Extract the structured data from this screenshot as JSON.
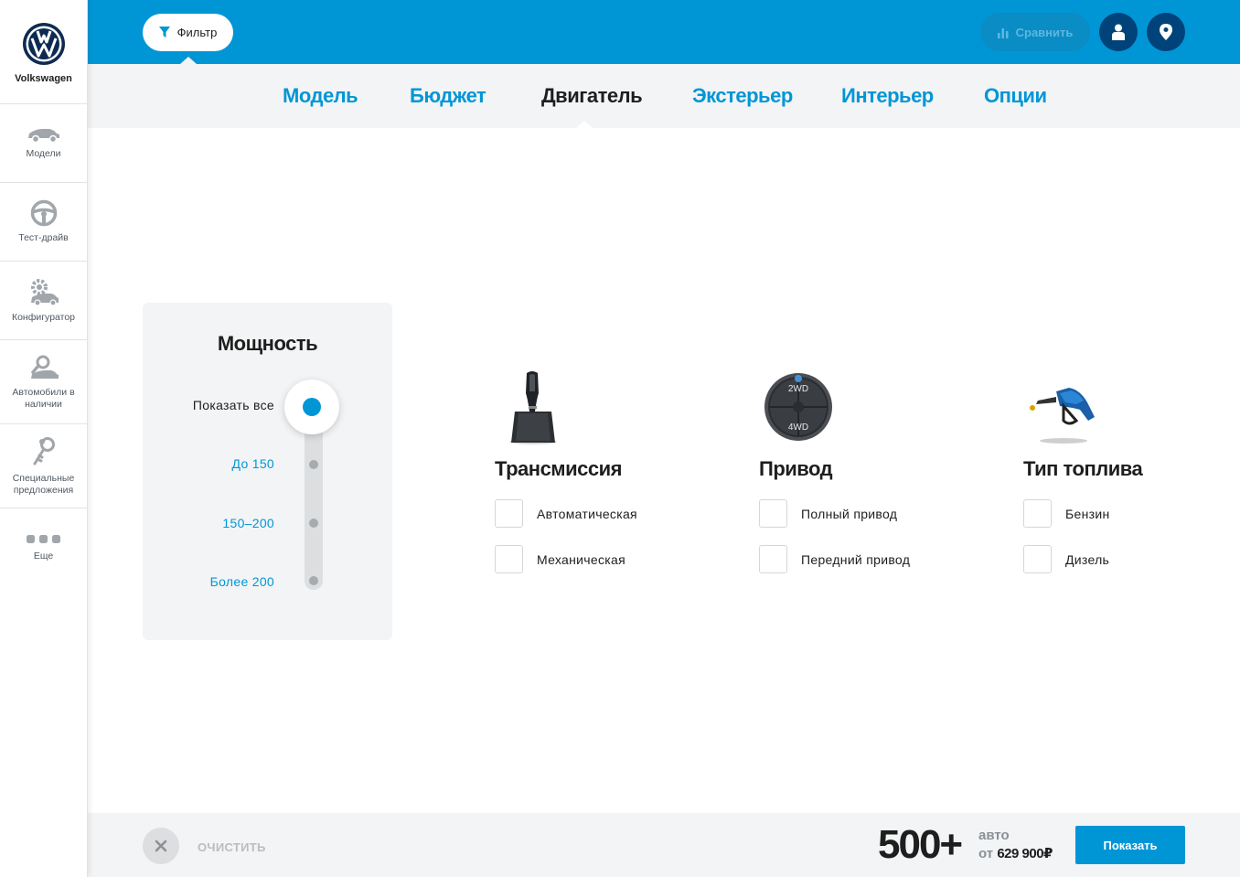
{
  "brand": {
    "name": "Volkswagen"
  },
  "sidebar": {
    "items": [
      {
        "label": "Модели",
        "icon": "car-icon"
      },
      {
        "label": "Тест-драйв",
        "icon": "steering-wheel-icon"
      },
      {
        "label": "Конфигуратор",
        "icon": "configurator-icon"
      },
      {
        "label": "Автомобили в наличии",
        "icon": "car-search-icon"
      },
      {
        "label": "Специальные предложения",
        "icon": "key-icon"
      },
      {
        "label": "Еще",
        "icon": "more-icon"
      }
    ]
  },
  "header": {
    "filter_label": "Фильтр",
    "compare_label": "Сравнить"
  },
  "tabs": [
    {
      "label": "Модель",
      "active": false
    },
    {
      "label": "Бюджет",
      "active": false
    },
    {
      "label": "Двигатель",
      "active": true
    },
    {
      "label": "Экстерьер",
      "active": false
    },
    {
      "label": "Интерьер",
      "active": false
    },
    {
      "label": "Опции",
      "active": false
    }
  ],
  "power": {
    "title": "Мощность",
    "options": [
      "Показать все",
      "До 150",
      "150–200",
      "Более 200"
    ],
    "selected": "Показать все"
  },
  "groups": {
    "transmission": {
      "title": "Трансмиссия",
      "options": [
        "Автоматическая",
        "Механическая"
      ]
    },
    "drive": {
      "title": "Привод",
      "options": [
        "Полный привод",
        "Передний привод"
      ],
      "icon_labels": [
        "2WD",
        "4WD"
      ]
    },
    "fuel": {
      "title": "Тип топлива",
      "options": [
        "Бензин",
        "Дизель"
      ]
    }
  },
  "footer": {
    "clear_label": "ОЧИСТИТЬ",
    "count": "500+",
    "count_unit": "авто",
    "price_prefix": "от",
    "price": "629 900₽",
    "show_label": "Показать"
  },
  "colors": {
    "accent": "#0096d6",
    "dark_button": "#00437a",
    "panel": "#f3f4f5"
  }
}
